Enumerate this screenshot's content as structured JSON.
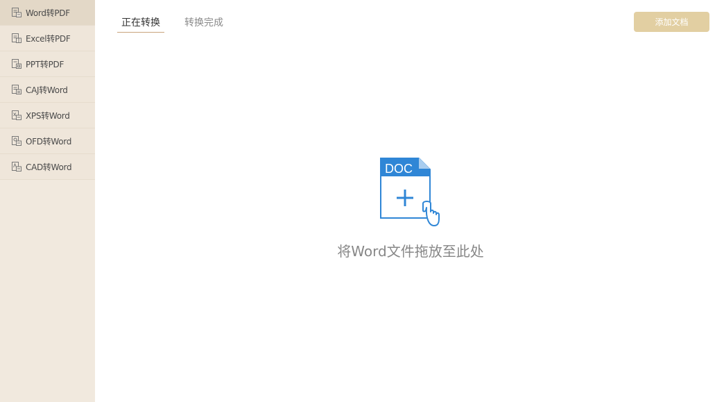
{
  "sidebar": {
    "items": [
      {
        "label": "Word转PDF",
        "icon": "word-file-icon",
        "active": true
      },
      {
        "label": "Excel转PDF",
        "icon": "excel-file-icon",
        "active": false
      },
      {
        "label": "PPT转PDF",
        "icon": "ppt-file-icon",
        "active": false
      },
      {
        "label": "CAJ转Word",
        "icon": "caj-file-icon",
        "active": false
      },
      {
        "label": "XPS转Word",
        "icon": "xps-file-icon",
        "active": false
      },
      {
        "label": "OFD转Word",
        "icon": "ofd-file-icon",
        "active": false
      },
      {
        "label": "CAD转Word",
        "icon": "cad-file-icon",
        "active": false
      }
    ]
  },
  "tabs": [
    {
      "label": "正在转换",
      "active": true
    },
    {
      "label": "转换完成",
      "active": false
    }
  ],
  "toolbar": {
    "add_label": "添加文档"
  },
  "drop_zone": {
    "badge": "DOC",
    "text": "将Word文件拖放至此处"
  },
  "colors": {
    "accent": "#2f86d6",
    "button": "#e2cfa2",
    "sidebar_bg": "#f1e9de",
    "active_item": "#e3d8c7",
    "tab_underline": "#c9a47c"
  }
}
